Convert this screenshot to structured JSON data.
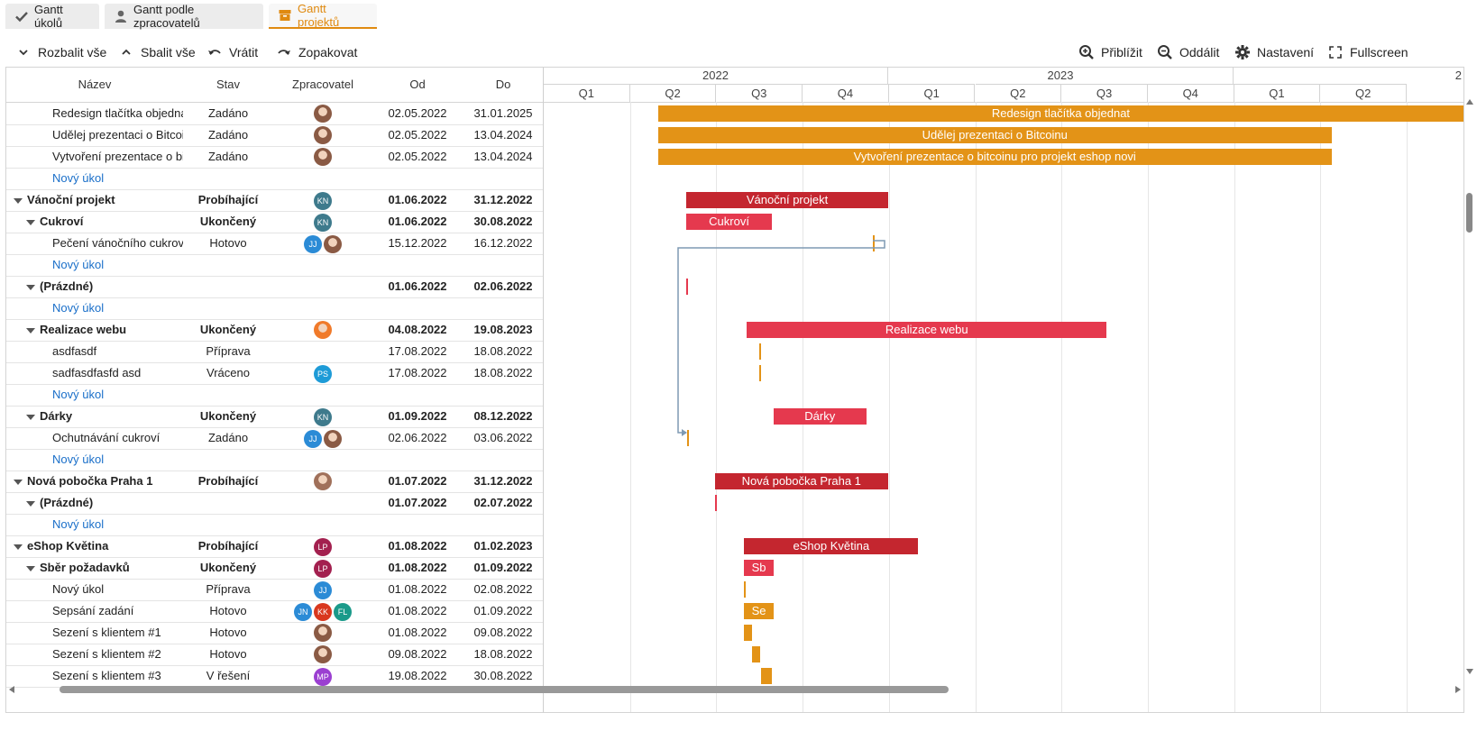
{
  "tabs": [
    {
      "label": "Gantt úkolů",
      "icon": "check-icon",
      "active": false
    },
    {
      "label": "Gantt podle zpracovatelů",
      "icon": "user-icon",
      "active": false
    },
    {
      "label": "Gantt projektů",
      "icon": "archive-icon",
      "active": true
    }
  ],
  "toolbar": {
    "expand_all": "Rozbalit vše",
    "collapse_all": "Sbalit vše",
    "undo": "Vrátit",
    "redo": "Zopakovat",
    "zoom_in": "Přiblížit",
    "zoom_out": "Oddálit",
    "settings": "Nastavení",
    "fullscreen": "Fullscreen"
  },
  "columns": {
    "name": "Název",
    "status": "Stav",
    "assignee": "Zpracovatel",
    "from": "Od",
    "to": "Do"
  },
  "timeline": {
    "years": [
      "2022",
      "2023",
      "2"
    ],
    "quarters": [
      "Q1",
      "Q2",
      "Q3",
      "Q4",
      "Q1",
      "Q2",
      "Q3",
      "Q4",
      "Q1",
      "Q2"
    ]
  },
  "colors": {
    "accent": "#e08a10",
    "task": "#e39317",
    "project": "#c4262f",
    "subproject": "#e5394e",
    "link": "#1a6fc9"
  },
  "rows": [
    {
      "name": "Redesign tlačítka objedna",
      "status": "Zadáno",
      "from": "02.05.2022",
      "to": "31.01.2025",
      "level": 2,
      "avatars": [
        {
          "type": "photo",
          "color": "#8a5a44"
        }
      ],
      "bar": "Redesign tlačítka objednat"
    },
    {
      "name": "Udělej prezentaci o Bitcoi",
      "status": "Zadáno",
      "from": "02.05.2022",
      "to": "13.04.2024",
      "level": 2,
      "avatars": [
        {
          "type": "photo",
          "color": "#8a5a44"
        }
      ],
      "bar": "Udělej prezentaci o Bitcoinu"
    },
    {
      "name": "Vytvoření prezentace o bi",
      "status": "Zadáno",
      "from": "02.05.2022",
      "to": "13.04.2024",
      "level": 2,
      "avatars": [
        {
          "type": "photo",
          "color": "#8a5a44"
        }
      ],
      "bar": "Vytvoření prezentace o bitcoinu pro projekt eshop novi"
    },
    {
      "name": "Nový úkol",
      "link": true,
      "level": 2
    },
    {
      "name": "Vánoční projekt",
      "status": "Probíhající",
      "from": "01.06.2022",
      "to": "31.12.2022",
      "level": 0,
      "bold": true,
      "avatars": [
        {
          "text": "KN",
          "color": "#3e7a8c"
        }
      ],
      "bar": "Vánoční projekt"
    },
    {
      "name": "Cukroví",
      "status": "Ukončený",
      "from": "01.06.2022",
      "to": "30.08.2022",
      "level": 1,
      "bold": true,
      "avatars": [
        {
          "text": "KN",
          "color": "#3e7a8c"
        }
      ],
      "bar": "Cukroví"
    },
    {
      "name": "Pečení vánočního cukroví",
      "status": "Hotovo",
      "from": "15.12.2022",
      "to": "16.12.2022",
      "level": 2,
      "avatars": [
        {
          "text": "JJ",
          "color": "#2b8bd6"
        },
        {
          "type": "photo",
          "color": "#8a5a44"
        }
      ]
    },
    {
      "name": "Nový úkol",
      "link": true,
      "level": 2
    },
    {
      "name": "(Prázdné)",
      "status": "",
      "from": "01.06.2022",
      "to": "02.06.2022",
      "level": 1,
      "bold": true
    },
    {
      "name": "Nový úkol",
      "link": true,
      "level": 2
    },
    {
      "name": "Realizace webu",
      "status": "Ukončený",
      "from": "04.08.2022",
      "to": "19.08.2023",
      "level": 1,
      "bold": true,
      "avatars": [
        {
          "type": "photo",
          "color": "#f07a2a"
        }
      ],
      "bar": "Realizace webu"
    },
    {
      "name": "asdfasdf",
      "status": "Příprava",
      "from": "17.08.2022",
      "to": "18.08.2022",
      "level": 2
    },
    {
      "name": "sadfasdfasfd asd",
      "status": "Vráceno",
      "from": "17.08.2022",
      "to": "18.08.2022",
      "level": 2,
      "avatars": [
        {
          "text": "PS",
          "color": "#1e9bd7"
        }
      ]
    },
    {
      "name": "Nový úkol",
      "link": true,
      "level": 2
    },
    {
      "name": "Dárky",
      "status": "Ukončený",
      "from": "01.09.2022",
      "to": "08.12.2022",
      "level": 1,
      "bold": true,
      "avatars": [
        {
          "text": "KN",
          "color": "#3e7a8c"
        }
      ],
      "bar": "Dárky"
    },
    {
      "name": "Ochutnávání cukroví",
      "status": "Zadáno",
      "from": "02.06.2022",
      "to": "03.06.2022",
      "level": 2,
      "avatars": [
        {
          "text": "JJ",
          "color": "#2b8bd6"
        },
        {
          "type": "photo",
          "color": "#8a5a44"
        }
      ]
    },
    {
      "name": "Nový úkol",
      "link": true,
      "level": 2
    },
    {
      "name": "Nová pobočka Praha 1",
      "status": "Probíhající",
      "from": "01.07.2022",
      "to": "31.12.2022",
      "level": 0,
      "bold": true,
      "avatars": [
        {
          "type": "photo",
          "color": "#a0705a"
        }
      ],
      "bar": "Nová pobočka Praha 1"
    },
    {
      "name": "(Prázdné)",
      "status": "",
      "from": "01.07.2022",
      "to": "02.07.2022",
      "level": 1,
      "bold": true
    },
    {
      "name": "Nový úkol",
      "link": true,
      "level": 2
    },
    {
      "name": "eShop Květina",
      "status": "Probíhající",
      "from": "01.08.2022",
      "to": "01.02.2023",
      "level": 0,
      "bold": true,
      "avatars": [
        {
          "text": "LP",
          "color": "#a3204f"
        }
      ],
      "bar": "eShop Květina"
    },
    {
      "name": "Sběr požadavků",
      "status": "Ukončený",
      "from": "01.08.2022",
      "to": "01.09.2022",
      "level": 1,
      "bold": true,
      "avatars": [
        {
          "text": "LP",
          "color": "#a3204f"
        }
      ],
      "bar": "Sb"
    },
    {
      "name": "Nový úkol",
      "status": "Příprava",
      "from": "01.08.2022",
      "to": "02.08.2022",
      "level": 2,
      "avatars": [
        {
          "text": "JJ",
          "color": "#2b8bd6"
        }
      ]
    },
    {
      "name": "Sepsání zadání",
      "status": "Hotovo",
      "from": "01.08.2022",
      "to": "01.09.2022",
      "level": 2,
      "avatars": [
        {
          "text": "JN",
          "color": "#2b8bd6"
        },
        {
          "text": "KK",
          "color": "#d9381e"
        },
        {
          "text": "FL",
          "color": "#1a9a8a"
        }
      ],
      "bar": "Se"
    },
    {
      "name": "Sezení s klientem #1",
      "status": "Hotovo",
      "from": "01.08.2022",
      "to": "09.08.2022",
      "level": 2,
      "avatars": [
        {
          "type": "photo",
          "color": "#8a5a44"
        }
      ]
    },
    {
      "name": "Sezení s klientem #2",
      "status": "Hotovo",
      "from": "09.08.2022",
      "to": "18.08.2022",
      "level": 2,
      "avatars": [
        {
          "type": "photo",
          "color": "#8a5a44"
        }
      ]
    },
    {
      "name": "Sezení s klientem #3",
      "status": "V řešení",
      "from": "19.08.2022",
      "to": "30.08.2022",
      "level": 2,
      "avatars": [
        {
          "text": "MP",
          "color": "#9b3fd1"
        }
      ]
    }
  ]
}
